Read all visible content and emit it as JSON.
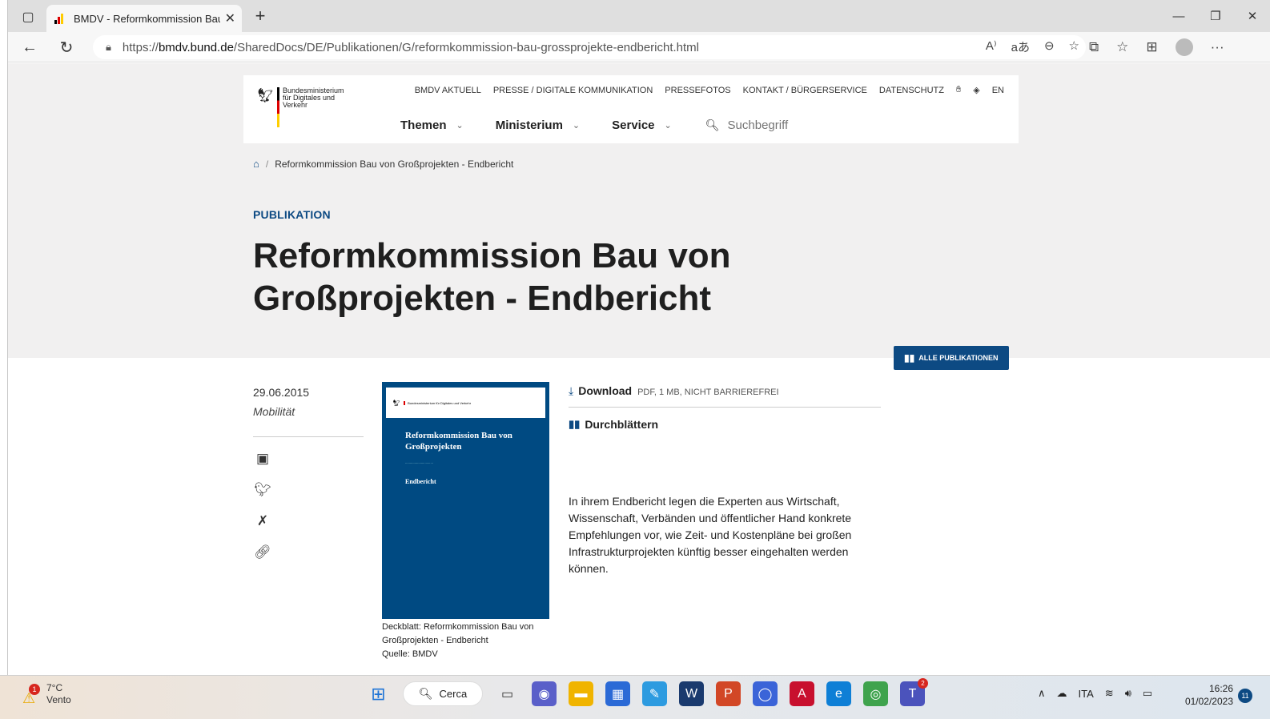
{
  "browser": {
    "tab_title": "BMDV - Reformkommission Bau",
    "url_prefix": "https://",
    "url_host": "bmdv.bund.de",
    "url_path": "/SharedDocs/DE/Publikationen/G/reformkommission-bau-grossprojekte-endbericht.html"
  },
  "header": {
    "logo_text": "Bundesministerium für Digitales und Verkehr",
    "top_nav": [
      "BMDV AKTUELL",
      "PRESSE / DIGITALE KOMMUNIKATION",
      "PRESSEFOTOS",
      "KONTAKT / BÜRGERSERVICE",
      "DATENSCHUTZ",
      "EN"
    ],
    "main_nav": [
      "Themen",
      "Ministerium",
      "Service"
    ],
    "search_placeholder": "Suchbegriff"
  },
  "breadcrumb": {
    "current": "Reformkommission Bau von Großprojekten - Endbericht"
  },
  "article": {
    "kicker": "PUBLIKATION",
    "title": "Reformkommission Bau von Großprojekten - Endbericht",
    "all_publications_label": "ALLE PUBLIKATIONEN",
    "date": "29.06.2015",
    "category": "Mobilität",
    "download_label": "Download",
    "download_meta": "PDF, 1 MB, NICHT BARRIEREFREI",
    "browse_label": "Durchblättern",
    "description": "In ihrem Endbericht legen die Experten aus Wirtschaft, Wissenschaft, Verbänden und öffentlicher Hand konkrete Empfehlungen vor, wie Zeit- und Kostenpläne bei großen Infrastrukturprojekten künftig besser eingehalten werden können.",
    "caption_line1": "Deckblatt: Reformkommission Bau von Großprojekten - Endbericht",
    "caption_line2": "Quelle: BMDV"
  },
  "cover": {
    "title": "Reformkommission Bau von Großprojekten",
    "end": "Endbericht"
  },
  "taskbar": {
    "temperature": "7°C",
    "weather": "Vento",
    "weather_badge": "1",
    "search_label": "Cerca",
    "teams_badge": "2",
    "language": "ITA",
    "time": "16:26",
    "date": "01/02/2023",
    "notifications": "11"
  },
  "colors": {
    "brand_blue": "#0d4a83",
    "band_grey": "#f1f0f0"
  }
}
